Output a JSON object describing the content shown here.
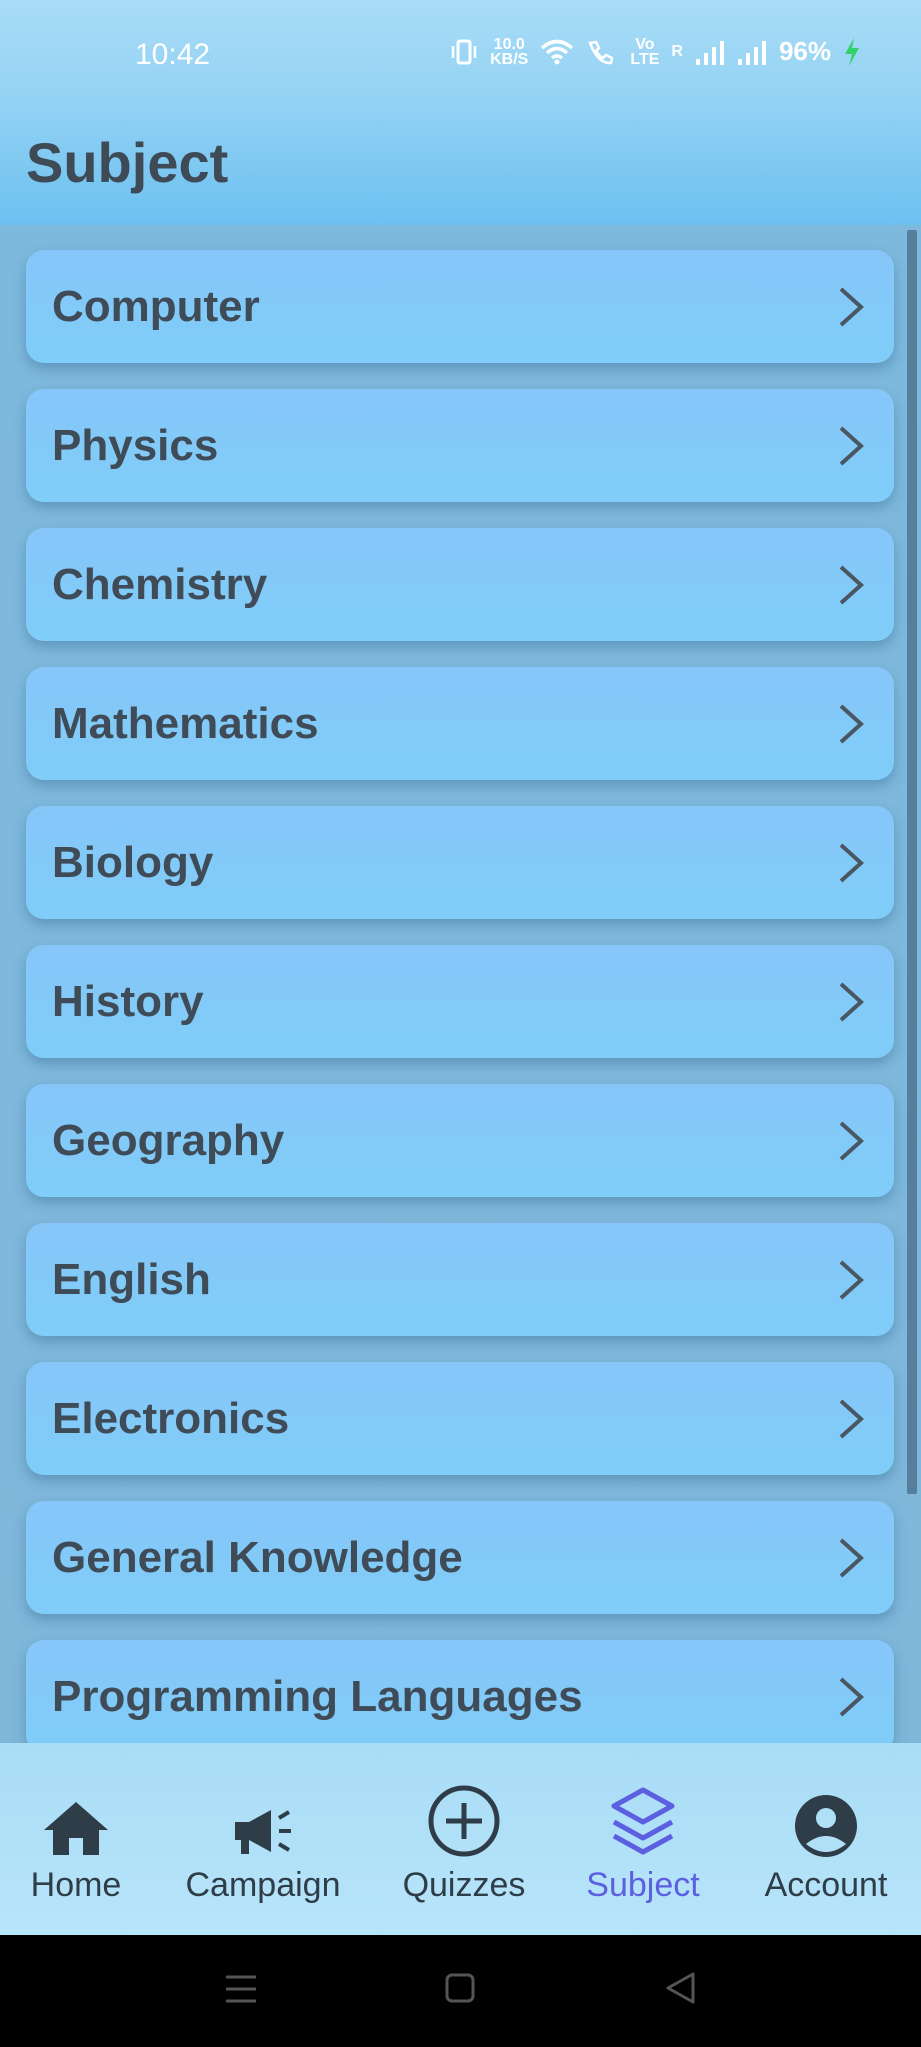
{
  "status_bar": {
    "time": "10:42",
    "net_speed_value": "10.0",
    "net_speed_unit": "KB/S",
    "volte_top": "Vo",
    "volte_bottom": "LTE",
    "roaming": "R",
    "battery": "96%"
  },
  "header": {
    "title": "Subject"
  },
  "subjects": [
    {
      "label": "Computer"
    },
    {
      "label": "Physics"
    },
    {
      "label": "Chemistry"
    },
    {
      "label": "Mathematics"
    },
    {
      "label": "Biology"
    },
    {
      "label": "History"
    },
    {
      "label": "Geography"
    },
    {
      "label": "English"
    },
    {
      "label": "Electronics"
    },
    {
      "label": "General Knowledge"
    },
    {
      "label": "Programming Languages"
    }
  ],
  "bottom_nav": {
    "items": [
      {
        "label": "Home",
        "icon": "home-icon"
      },
      {
        "label": "Campaign",
        "icon": "megaphone-icon"
      },
      {
        "label": "Quizzes",
        "icon": "plus-circle-icon"
      },
      {
        "label": "Subject",
        "icon": "layers-icon",
        "active": true
      },
      {
        "label": "Account",
        "icon": "account-circle-icon"
      }
    ]
  },
  "colors": {
    "accent": "#5c5fe0",
    "header_bg": "#93d2f4",
    "card_bg": "#86c6f9",
    "text": "#3f4b56"
  }
}
